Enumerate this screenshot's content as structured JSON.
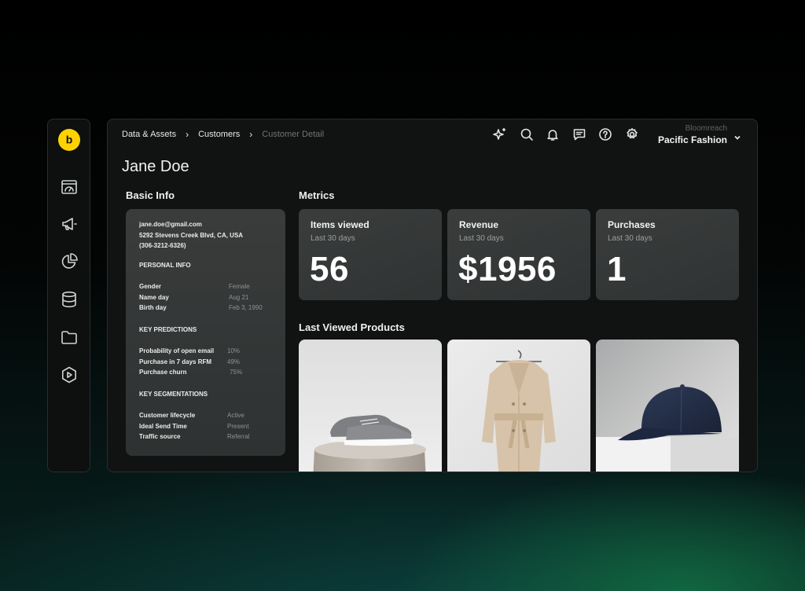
{
  "breadcrumb": [
    "Data & Assets",
    "Customers",
    "Customer Detail"
  ],
  "top_icons": [
    "sparkle-icon",
    "search-icon",
    "bell-icon",
    "chat-icon",
    "help-icon",
    "gear-icon"
  ],
  "account": {
    "org": "Bloomreach",
    "name": "Pacific Fashion"
  },
  "sidebar": {
    "logo_letter": "b",
    "items": [
      "dashboard-icon",
      "megaphone-icon",
      "pie-chart-icon",
      "database-icon",
      "folder-icon",
      "play-hexagon-icon"
    ]
  },
  "page_title": "Jane Doe",
  "basic_info": {
    "title": "Basic Info",
    "email": "jane.doe@gmail.com",
    "address": "5292 Stevens Creek Blvd, CA, USA",
    "phone": "(306-3212-6326)",
    "personal_heading": "PERSONAL INFO",
    "personal": [
      {
        "key": "Gender",
        "value": "Female"
      },
      {
        "key": "Name day",
        "value": "Aug 21"
      },
      {
        "key": "Birth day",
        "value": "Feb 3, 1990"
      }
    ],
    "predictions_heading": "KEY PREDICTIONS",
    "predictions": [
      {
        "key": "Probability of open email",
        "value": "10%"
      },
      {
        "key": "Purchase in 7 days RFM",
        "value": "49%"
      },
      {
        "key": "Purchase churn",
        "value": "75%"
      }
    ],
    "segmentations_heading": "KEY SEGMENTATIONS",
    "segmentations": [
      {
        "key": "Customer lifecycle",
        "value": "Active"
      },
      {
        "key": "Ideal Send Time",
        "value": "Present"
      },
      {
        "key": "Traffic source",
        "value": "Referral"
      }
    ]
  },
  "metrics": {
    "title": "Metrics",
    "items": [
      {
        "title": "Items viewed",
        "period": "Last 30 days",
        "value": "56"
      },
      {
        "title": "Revenue",
        "period": "Last 30 days",
        "value": "$1956"
      },
      {
        "title": "Purchases",
        "period": "Last 30 days",
        "value": "1"
      }
    ]
  },
  "products": {
    "title": "Last Viewed Products",
    "items": [
      "sneakers-image",
      "trench-coat-image",
      "baseball-cap-image"
    ]
  },
  "colors": {
    "brand_yellow": "#ffd200",
    "panel": "#111212",
    "card": "#363838"
  }
}
